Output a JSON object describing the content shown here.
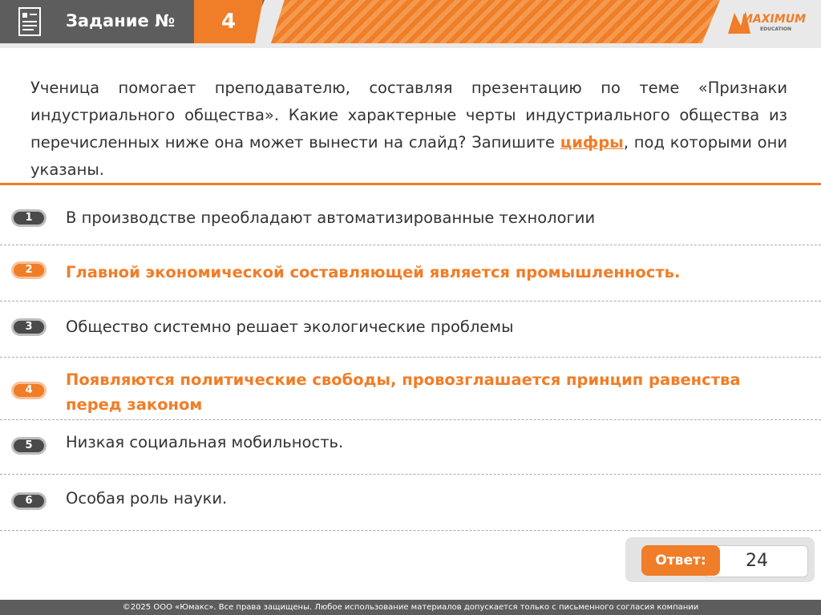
{
  "header": {
    "title": "Задание №",
    "number": "4",
    "logo_text": "MAXIMUM",
    "logo_sub": "EDUCATION",
    "accent_color": "#f07d27"
  },
  "question": {
    "part1": "Ученица помогает преподавателю, составляя презентацию по теме «Признаки индустриального общества». Какие характерные черты индустриального общества из перечисленных ниже она может вынести на слайд? Запишите ",
    "highlight": "цифры",
    "part2": ", под которыми они указаны."
  },
  "items": [
    {
      "num": "1",
      "text": "В производстве преобладают автоматизированные технологии",
      "highlighted": false
    },
    {
      "num": "2",
      "text": "Главной экономической составляющей является промышленность.",
      "highlighted": true
    },
    {
      "num": "3",
      "text": "Общество системно решает экологические проблемы",
      "highlighted": false
    },
    {
      "num": "4",
      "text": "Появляются политические свободы, провозглашается принцип равенства перед законом",
      "highlighted": true
    },
    {
      "num": "5",
      "text": "Низкая социальная мобильность.",
      "highlighted": false
    },
    {
      "num": "6",
      "text": "Особая роль науки.",
      "highlighted": false
    }
  ],
  "answer": {
    "label": "Ответ:",
    "value": "24"
  },
  "footer": "©2025 ООО «Юмакс». Все права защищены. Любое использование материалов допускается только с письменного согласия компании"
}
